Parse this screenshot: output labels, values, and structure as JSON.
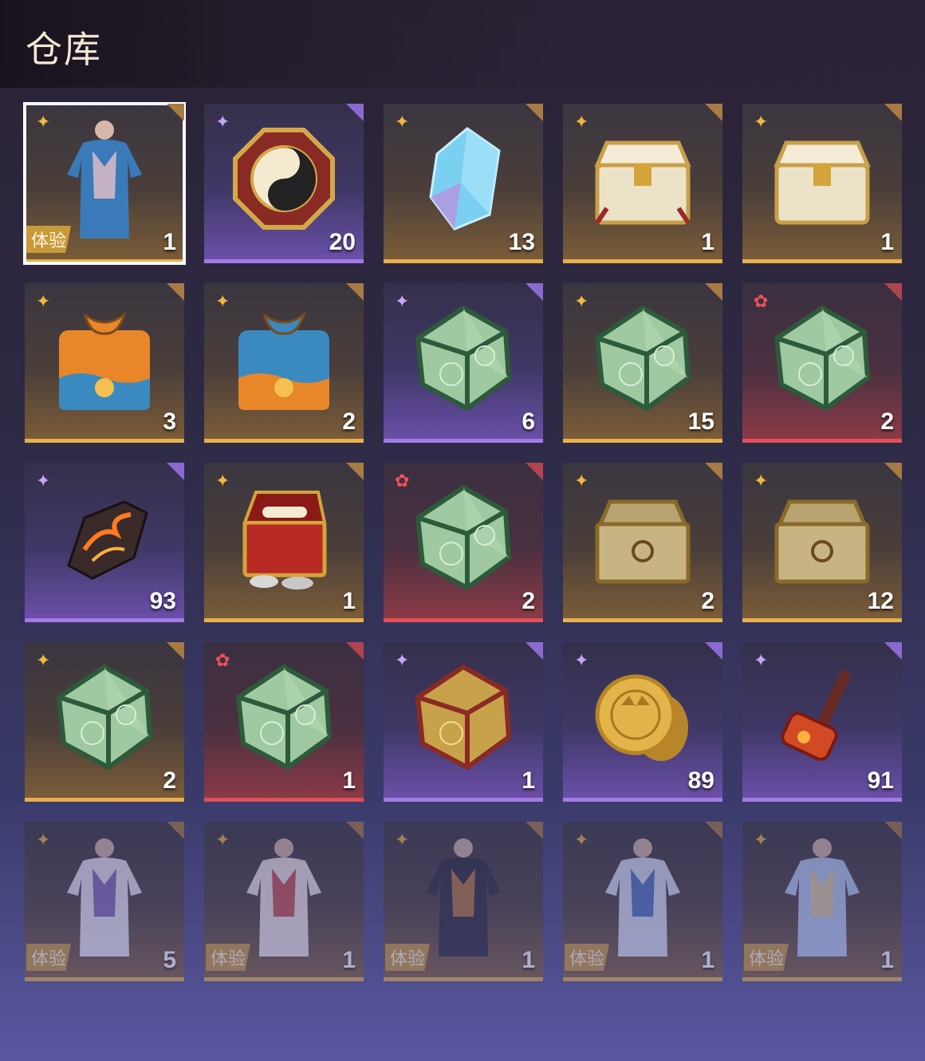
{
  "title": "仓库",
  "trial_label": "体验",
  "colors": {
    "gold": "#e8b04c",
    "purple": "#a27ae6",
    "red": "#e0505a"
  },
  "items": [
    {
      "name": "outfit-blue-dress",
      "rarity": "gold",
      "count": "1",
      "trial": true,
      "selected": true,
      "icon": "outfit-female-blue"
    },
    {
      "name": "octagon-medallion",
      "rarity": "purple",
      "count": "20",
      "icon": "octagon-medallion"
    },
    {
      "name": "blue-crystal",
      "rarity": "gold",
      "count": "13",
      "icon": "crystal"
    },
    {
      "name": "ornate-white-chest",
      "rarity": "gold",
      "count": "1",
      "icon": "chest-white-ornate"
    },
    {
      "name": "white-chest",
      "rarity": "gold",
      "count": "1",
      "icon": "chest-white"
    },
    {
      "name": "orange-gift-bundle",
      "rarity": "gold",
      "count": "3",
      "icon": "gift-orange"
    },
    {
      "name": "blue-gift-bundle",
      "rarity": "gold",
      "count": "2",
      "icon": "gift-blue"
    },
    {
      "name": "jade-polyhedron",
      "rarity": "purple",
      "count": "6",
      "icon": "jade-die"
    },
    {
      "name": "jade-polyhedron",
      "rarity": "gold",
      "count": "15",
      "icon": "jade-die"
    },
    {
      "name": "jade-polyhedron",
      "rarity": "red",
      "count": "2",
      "icon": "jade-die"
    },
    {
      "name": "fire-ore",
      "rarity": "purple",
      "count": "93",
      "icon": "fire-ore"
    },
    {
      "name": "scroll-treasure-chest",
      "rarity": "gold",
      "count": "1",
      "icon": "chest-red-scrolls"
    },
    {
      "name": "jade-polyhedron",
      "rarity": "red",
      "count": "2",
      "icon": "jade-die"
    },
    {
      "name": "bronze-chest",
      "rarity": "gold",
      "count": "2",
      "icon": "chest-bronze"
    },
    {
      "name": "bronze-chest",
      "rarity": "gold",
      "count": "12",
      "icon": "chest-bronze"
    },
    {
      "name": "jade-polyhedron",
      "rarity": "gold",
      "count": "2",
      "icon": "jade-die"
    },
    {
      "name": "jade-polyhedron",
      "rarity": "red",
      "count": "1",
      "icon": "jade-die"
    },
    {
      "name": "gold-polyhedron",
      "rarity": "purple",
      "count": "1",
      "icon": "gold-die"
    },
    {
      "name": "gold-coin",
      "rarity": "purple",
      "count": "89",
      "icon": "coin"
    },
    {
      "name": "fire-hammer",
      "rarity": "purple",
      "count": "91",
      "icon": "hammer"
    },
    {
      "name": "outfit-white-fur",
      "rarity": "gold",
      "count": "5",
      "trial": true,
      "faded": true,
      "icon": "outfit-white"
    },
    {
      "name": "outfit-shrine-maiden",
      "rarity": "gold",
      "count": "1",
      "trial": true,
      "faded": true,
      "icon": "outfit-red-white"
    },
    {
      "name": "outfit-dark-warrior",
      "rarity": "gold",
      "count": "1",
      "trial": true,
      "faded": true,
      "icon": "outfit-dark"
    },
    {
      "name": "outfit-blue-gown",
      "rarity": "gold",
      "count": "1",
      "trial": true,
      "faded": true,
      "icon": "outfit-blue-gown"
    },
    {
      "name": "outfit-lightblue-gown",
      "rarity": "gold",
      "count": "1",
      "trial": true,
      "faded": true,
      "icon": "outfit-lightblue"
    }
  ]
}
